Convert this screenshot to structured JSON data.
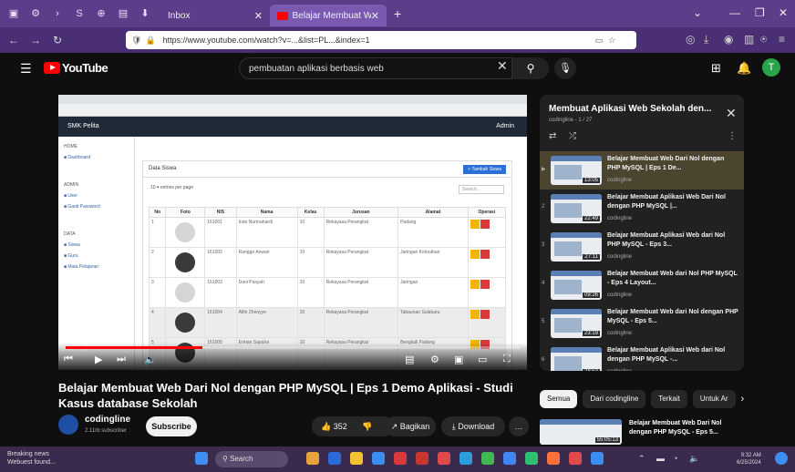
{
  "browser": {
    "tab1_label": "Inbox",
    "tab2_label": "Belajar Membuat Web Dari N...",
    "url": "https://www.youtube.com/watch?v=...&list=PL...&index=1"
  },
  "header": {
    "logo_text": "YouTube",
    "search_query": "pembuatan aplikasi berbasis web",
    "avatar_initial": "T"
  },
  "video_screen": {
    "app_name": "SMK Pelita",
    "admin_label": "Admin",
    "sidebar": {
      "sections": [
        "HOME",
        "ADMIN",
        "DATA"
      ],
      "home_items": [
        "Dashboard"
      ],
      "admin_items": [
        "User",
        "Ganti Password"
      ],
      "data_items": [
        "Siswa",
        "Guru",
        "Mata Pelajaran"
      ]
    },
    "card_title": "Data Siswa",
    "add_button": "+ Tambah Siswa",
    "entries_label": "10  ▾  entries per page",
    "search_placeholder": "Search...",
    "columns": [
      "No",
      "Foto",
      "NIS",
      "Nama",
      "Kelas",
      "Jurusan",
      "Alamat",
      "Operasi"
    ],
    "rows": [
      [
        "1",
        "",
        "161001",
        "Indo Nurmahardi",
        "10",
        "Rekayasa Perangkat",
        "Padang"
      ],
      [
        "2",
        "",
        "161002",
        "Ranggo Anwari",
        "10",
        "Rekayasa Perangkat",
        "Jaringan Kelurahan"
      ],
      [
        "3",
        "",
        "161003",
        "Dani Pasyah",
        "10",
        "Rekayasa Perangkat",
        "Jaringan"
      ],
      [
        "4",
        "",
        "161004",
        "Alfin Zhenyye",
        "10",
        "Rekayasa Perangkat",
        "Tabaunan Sulabaru"
      ],
      [
        "5",
        "",
        "161005",
        "Erman Saputra",
        "10",
        "Rekayasa Perangkat",
        "Bengkali Padang"
      ]
    ],
    "dark_photo_rows": [
      1,
      3,
      4
    ],
    "timecode": "0:04 / 7:14"
  },
  "playlist": {
    "title": "Membuat Aplikasi Web Sekolah den...",
    "subtitle": "codingline - 1 / 27",
    "items": [
      {
        "index": "▶",
        "title": "Belajar Membuat Web Dari Nol dengan PHP MySQL | Eps 1 De...",
        "channel": "codingline",
        "duration": "13:05",
        "active": true
      },
      {
        "index": "2",
        "title": "Belajar Membuat Aplikasi Web Dari Nol dengan PHP MySQL |...",
        "channel": "codingline",
        "duration": "22:49",
        "active": false
      },
      {
        "index": "3",
        "title": "Belajar Membuat Aplikasi Web dari Nol PHP MySQL - Eps 3...",
        "channel": "codingline",
        "duration": "27:11",
        "active": false
      },
      {
        "index": "4",
        "title": "Belajar Membuat Web dari Nol PHP MySQL - Eps 4 Layout...",
        "channel": "codingline",
        "duration": "09:26",
        "active": false
      },
      {
        "index": "5",
        "title": "Belajar Membuat Web dari Nol dengan PHP MySQL - Eps 5...",
        "channel": "codingline",
        "duration": "23:19",
        "active": false
      },
      {
        "index": "6",
        "title": "Belajar Membuat Aplikasi Web dari Nol dengan PHP MySQL -...",
        "channel": "codingline",
        "duration": "28:53",
        "active": false
      }
    ]
  },
  "video": {
    "title": "Belajar Membuat Web Dari Nol dengan PHP MySQL | Eps 1 Demo Aplikasi - Studi Kasus database Sekolah",
    "channel": "codingline",
    "subscribers": "2.11rb subscriber",
    "subscribe_label": "Subscribe",
    "likes": "352",
    "share_label": "Bagikan",
    "download_label": "Download",
    "more_label": "…"
  },
  "chips": [
    "Semua",
    "Dari codingline",
    "Terkait",
    "Untuk Ar"
  ],
  "recommended": {
    "title": "Belajar Membuat Web Dari Nol dengan PHP MySQL - Eps 5...",
    "duration": "55:05:13"
  },
  "taskbar": {
    "news_line1": "Breaking news",
    "news_line2": "Webuest found...",
    "search_label": "Search",
    "time": "9:32 AM",
    "date": "6/25/2024"
  },
  "colors": {
    "browser_tabbar": "#5b3d8a",
    "youtube_red": "#ff0000",
    "playlist_active": "#4b4530",
    "edit_button": "#f2b400",
    "delete_button": "#d83a3a"
  }
}
